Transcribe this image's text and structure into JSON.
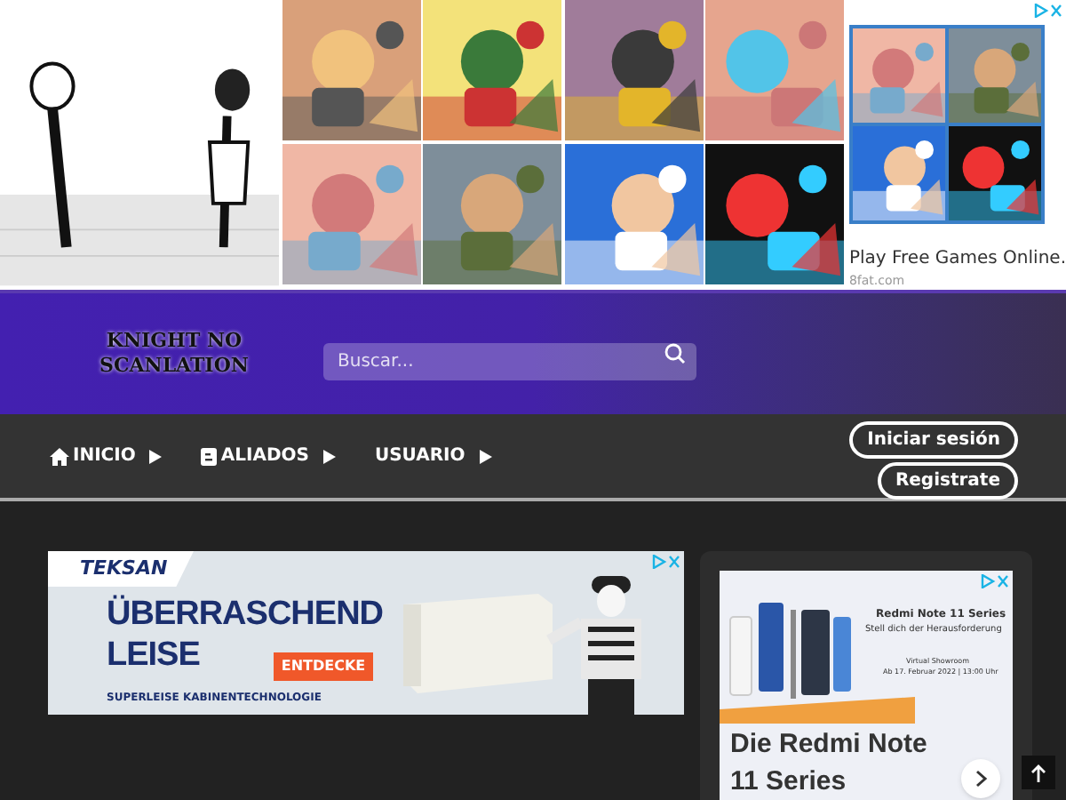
{
  "top_ad": {
    "side_ad": {
      "title": "Play Free Games Online.",
      "domain": "8fat.com"
    }
  },
  "header": {
    "logo": "KNIGHT NO SCANLATION",
    "search": {
      "placeholder": "Buscar..."
    }
  },
  "nav": {
    "items": [
      {
        "label": "INICIO"
      },
      {
        "label": "ALIADOS"
      },
      {
        "label": "USUARIO"
      }
    ],
    "buttons": [
      "Iniciar sesión",
      "Registrate"
    ]
  },
  "banner_ad": {
    "brand": "TEKSAN",
    "headline": [
      "ÜBERRASCHEND",
      "LEISE"
    ],
    "cta": "ENTDECKE",
    "tagline": "SUPERLEISE KABINENTECHNOLOGIE"
  },
  "sidebar_ad": {
    "product": "Redmi Note 11 Series",
    "subtitle": "Stell dich der Herausforderung",
    "event": "Virtual Showroom",
    "date": "Ab 17. Februar 2022 | 13:00 Uhr",
    "headline": "Die Redmi Note 11 Series"
  }
}
